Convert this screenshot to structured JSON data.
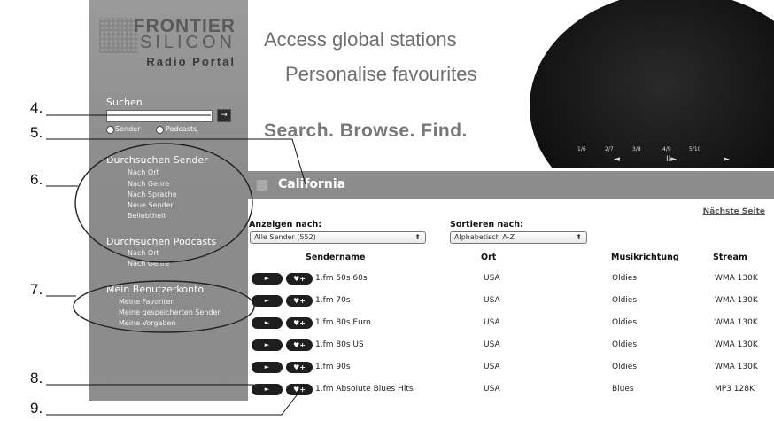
{
  "callouts": [
    "4.",
    "5.",
    "6.",
    "7.",
    "8.",
    "9."
  ],
  "sidebar": {
    "brand_line1": "FRONTIER",
    "brand_line2": "SILICON",
    "brand_line3": "Radio Portal",
    "search_heading": "Suchen",
    "search_go": "→",
    "radio_sender": "Sender",
    "radio_podcasts": "Podcasts",
    "browse_stations_heading": "Durchsuchen Sender",
    "browse_stations_items": [
      "Nach Ort",
      "Nach Genre",
      "Nach Sprache",
      "Neue Sender",
      "Beliebtheit"
    ],
    "browse_podcasts_heading": "Durchsuchen Podcasts",
    "browse_podcasts_items": [
      "Nach Ort",
      "Nach Genre"
    ],
    "account_heading": "Mein Benutzerkonto",
    "account_items": [
      "Meine Favoriten",
      "Meine gespeicherten Sender",
      "Meine Vorgaben"
    ]
  },
  "banner": {
    "tagline1": "Access global stations",
    "tagline2": "Personalise favourites",
    "tagline3": "Search. Browse. Find.",
    "presets": [
      "1/6",
      "2/7",
      "3/8",
      "4/9",
      "5/10"
    ],
    "nav": [
      "◄",
      "II►",
      "►"
    ]
  },
  "location_title": "California",
  "next_page": "Nächste Seite",
  "filter": {
    "show_label": "Anzeigen nach:",
    "show_value": "Alle Sender (552)",
    "sort_label": "Sortieren nach:",
    "sort_value": "Alphabetisch A-Z"
  },
  "table": {
    "headers": [
      "Sendername",
      "Ort",
      "Musikrichtung",
      "Stream"
    ],
    "play_glyph": "►",
    "fav_glyph": "♥+",
    "rows": [
      [
        "1.fm 50s 60s",
        "USA",
        "Oldies",
        "WMA 130K"
      ],
      [
        "1.fm 70s",
        "USA",
        "Oldies",
        "WMA 130K"
      ],
      [
        "1.fm 80s Euro",
        "USA",
        "Oldies",
        "WMA 130K"
      ],
      [
        "1.fm 80s US",
        "USA",
        "Oldies",
        "WMA 130K"
      ],
      [
        "1.fm 90s",
        "USA",
        "Oldies",
        "WMA 130K"
      ],
      [
        "1.fm Absolute Blues Hits",
        "USA",
        "Blues",
        "MP3 128K"
      ]
    ]
  },
  "colors": {
    "sidebar": "#8d8d8d",
    "bar": "#8c8c8c",
    "button": "#1e1e1e"
  }
}
